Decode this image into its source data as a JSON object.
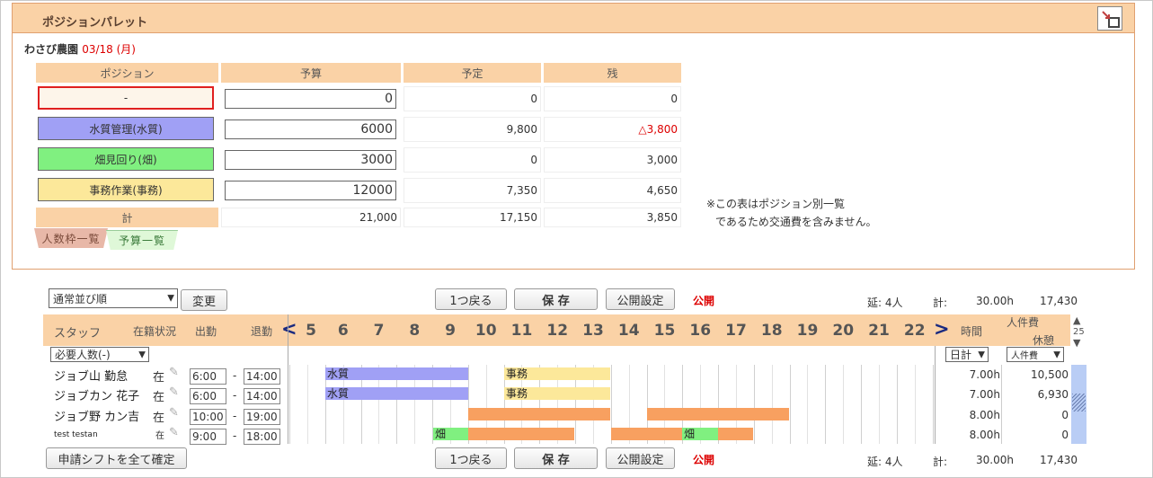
{
  "panel": {
    "title": "ポジションパレット",
    "icon": "window-toggle-icon"
  },
  "farm": {
    "name": "わさび農園",
    "date": "03/18 (月)"
  },
  "table": {
    "headers": [
      "ポジション",
      "予算",
      "予定",
      "残"
    ],
    "rows": [
      {
        "position": "-",
        "color": "#fdf5ea",
        "border": "#e02020",
        "budget": "0",
        "planned": "0",
        "remaining": "0",
        "remaining_red": false
      },
      {
        "position": "水質管理(水質)",
        "color": "#a0a0f5",
        "border": "#555",
        "budget": "6000",
        "planned": "9,800",
        "remaining": "△3,800",
        "remaining_red": true
      },
      {
        "position": "畑見回り(畑)",
        "color": "#80f080",
        "border": "#555",
        "budget": "3000",
        "planned": "0",
        "remaining": "3,000",
        "remaining_red": false
      },
      {
        "position": "事務作業(事務)",
        "color": "#fce89a",
        "border": "#555",
        "budget": "12000",
        "planned": "7,350",
        "remaining": "4,650",
        "remaining_red": false
      }
    ],
    "total": {
      "label": "計",
      "budget": "21,000",
      "planned": "17,150",
      "remaining": "3,850"
    }
  },
  "note": {
    "line1": "※この表はポジション別一覧",
    "line2": "であるため交通費を含みません。"
  },
  "tabs": {
    "headcount": "人数枠一覧",
    "budget": "予算一覧"
  },
  "toolbar": {
    "sort_select": "通常並び順",
    "change": "変更",
    "back": "1つ戻る",
    "save": "保 存",
    "publish_settings": "公開設定",
    "publish_status": "公開",
    "total_people": "延: 4人",
    "total_label": "計:",
    "total_hours": "30.00h",
    "total_cost": "17,430"
  },
  "grid": {
    "staff_header": "スタッフ",
    "status_header": "在籍状況",
    "start_header": "出勤",
    "end_header": "退勤",
    "prev": "<",
    "next": ">",
    "hours": [
      "5",
      "6",
      "7",
      "8",
      "9",
      "10",
      "11",
      "12",
      "13",
      "14",
      "15",
      "16",
      "17",
      "18",
      "19",
      "20",
      "21",
      "22"
    ],
    "time_header": "時間",
    "cost_header": "人件費",
    "break_header": "休憩",
    "page_count": "25",
    "required_select": "必要人数(-)",
    "daily_select": "日計",
    "cost_select": "人件費"
  },
  "staff": [
    {
      "name": "ジョブ山 勤怠",
      "status": "在",
      "start": "6:00",
      "end": "14:00",
      "hours": "7.00h",
      "cost": "10,500"
    },
    {
      "name": "ジョブカン 花子",
      "status": "在",
      "start": "6:00",
      "end": "14:00",
      "hours": "7.00h",
      "cost": "6,930"
    },
    {
      "name": "ジョブ野 カン吉",
      "status": "在",
      "start": "10:00",
      "end": "19:00",
      "hours": "8.00h",
      "cost": "0"
    },
    {
      "name": "test testan",
      "status": "在",
      "start": "9:00",
      "end": "18:00",
      "hours": "8.00h",
      "cost": "0"
    }
  ],
  "bar_labels": {
    "water": "水質",
    "office": "事務",
    "field": "畑"
  },
  "footer": {
    "confirm_all": "申請シフトを全て確定",
    "back": "1つ戻る",
    "save": "保 存",
    "publish_settings": "公開設定",
    "publish_status": "公開",
    "total_people": "延: 4人",
    "total_label": "計:",
    "total_hours": "30.00h",
    "total_cost": "17,430"
  },
  "colors": {
    "header": "#fad2a6",
    "water": "#a0a0f5",
    "office": "#fce89a",
    "field": "#80f080",
    "work": "#f8a060"
  }
}
